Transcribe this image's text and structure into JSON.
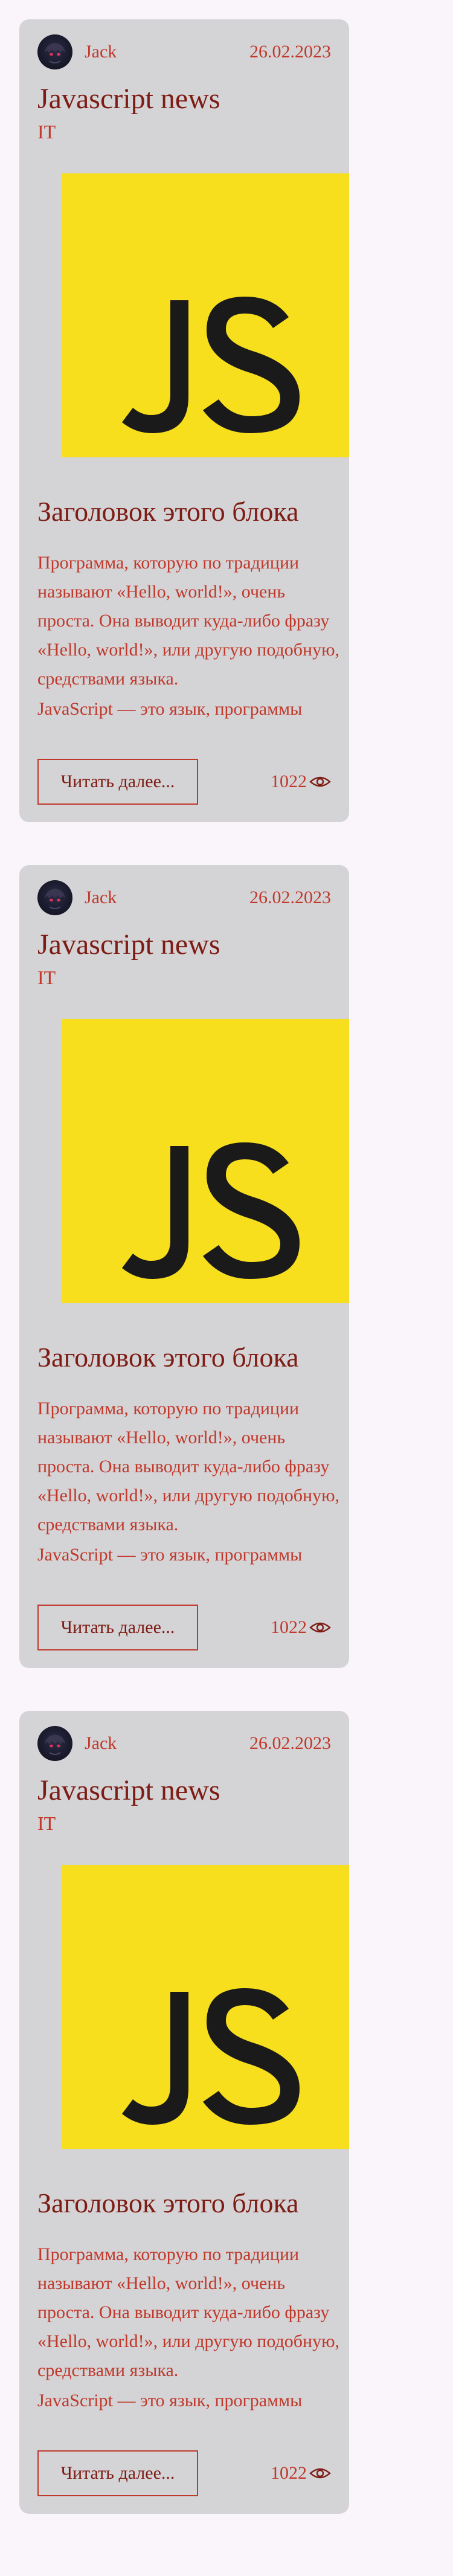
{
  "colors": {
    "page_background": "#f9f5fb",
    "card_background": "#d4d3d6",
    "text_dark_red": "#7d1c14",
    "text_red": "#c0392b",
    "js_logo_yellow": "#f7df1e",
    "js_logo_text": "#1a1a1a"
  },
  "icons": {
    "avatar": "anime-character-avatar-icon",
    "views": "eye-icon",
    "image": "javascript-logo-icon"
  },
  "cards": [
    {
      "author": "Jack",
      "date": "26.02.2023",
      "title": "Javascript news",
      "category": "IT",
      "image_text": "JS",
      "block_title": "Заголовок этого блока",
      "description": "Программа, которую по традиции называют «Hello, world!», очень проста. Она выводит куда-либо фразу «Hello, world!», или другую подобную, средствами языка.",
      "excerpt": "JavaScript — это язык, программы",
      "read_more_label": "Читать далее...",
      "views": "1022"
    },
    {
      "author": "Jack",
      "date": "26.02.2023",
      "title": "Javascript news",
      "category": "IT",
      "image_text": "JS",
      "block_title": "Заголовок этого блока",
      "description": "Программа, которую по традиции называют «Hello, world!», очень проста. Она выводит куда-либо фразу «Hello, world!», или другую подобную, средствами языка.",
      "excerpt": "JavaScript — это язык, программы",
      "read_more_label": "Читать далее...",
      "views": "1022"
    },
    {
      "author": "Jack",
      "date": "26.02.2023",
      "title": "Javascript news",
      "category": "IT",
      "image_text": "JS",
      "block_title": "Заголовок этого блока",
      "description": "Программа, которую по традиции называют «Hello, world!», очень проста. Она выводит куда-либо фразу «Hello, world!», или другую подобную, средствами языка.",
      "excerpt": "JavaScript — это язык, программы",
      "read_more_label": "Читать далее...",
      "views": "1022"
    }
  ]
}
